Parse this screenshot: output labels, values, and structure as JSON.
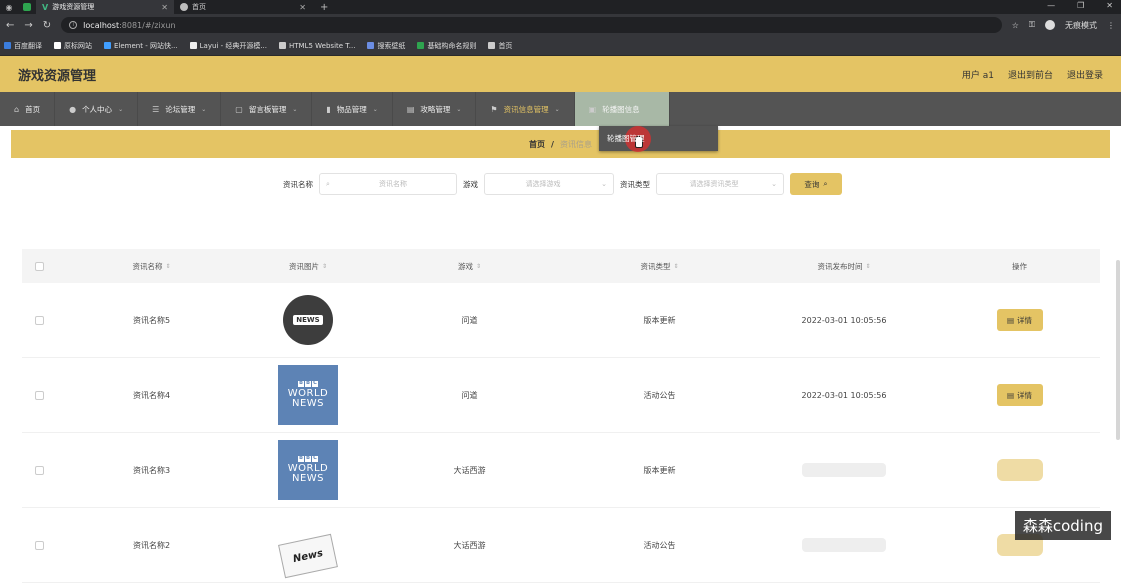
{
  "browser": {
    "tabs": [
      {
        "title": "游戏资源管理"
      },
      {
        "title": "首页"
      }
    ],
    "url_host": "localhost",
    "url_port": ":8081",
    "url_path": "/#/zixun",
    "incognito_label": "无痕模式",
    "bookmarks": [
      {
        "label": "百度翻译",
        "color": "#3b7ddd"
      },
      {
        "label": "原标网站",
        "color": "#ffffff"
      },
      {
        "label": "Element - 网站快...",
        "color": "#409eff"
      },
      {
        "label": "Layui - 经典开源模...",
        "color": "#eeeeee"
      },
      {
        "label": "HTML5 Website T...",
        "color": "#cccccc"
      },
      {
        "label": "搜索壁纸",
        "color": "#6b8de3"
      },
      {
        "label": "基础构命名规则",
        "color": "#2ea44f"
      },
      {
        "label": "首页",
        "color": "#cccccc"
      }
    ]
  },
  "app": {
    "title": "游戏资源管理",
    "user": "用户 a1",
    "back_front": "退出到前台",
    "logout": "退出登录",
    "accent": "#e4c464"
  },
  "nav": [
    {
      "label": "首页",
      "icon": "home-icon"
    },
    {
      "label": "个人中心",
      "icon": "user-icon"
    },
    {
      "label": "论坛管理",
      "icon": "list-icon"
    },
    {
      "label": "留言板管理",
      "icon": "message-icon"
    },
    {
      "label": "物品管理",
      "icon": "chart-icon"
    },
    {
      "label": "攻略管理",
      "icon": "doc-icon"
    },
    {
      "label": "资讯信息管理",
      "icon": "flag-icon"
    },
    {
      "label": "轮播图信息",
      "icon": "image-icon"
    }
  ],
  "dropdown": {
    "item": "轮播图管理"
  },
  "breadcrumb": {
    "home": "首页",
    "sep": "/",
    "current": "资讯信息"
  },
  "search": {
    "name_label": "资讯名称",
    "name_placeholder": "资讯名称",
    "game_label": "游戏",
    "game_placeholder": "请选择游戏",
    "type_label": "资讯类型",
    "type_placeholder": "请选择资讯类型",
    "query_label": "查询"
  },
  "table": {
    "headers": {
      "name": "资讯名称",
      "image": "资讯图片",
      "game": "游戏",
      "type": "资讯类型",
      "time": "资讯发布时间",
      "op": "操作"
    },
    "detail_label": "详情",
    "rows": [
      {
        "name": "资讯名称5",
        "image": "news-globe",
        "image_text": "NEWS",
        "game": "问道",
        "type": "版本更新",
        "time": "2022-03-01 10:05:56"
      },
      {
        "name": "资讯名称4",
        "image": "bbc-world-news",
        "image_logo": [
          "B",
          "B",
          "C"
        ],
        "image_l1": "WORLD",
        "image_l2": "NEWS",
        "game": "问道",
        "type": "活动公告",
        "time": "2022-03-01 10:05:56"
      },
      {
        "name": "资讯名称3",
        "image": "bbc-world-news",
        "image_logo": [
          "B",
          "B",
          "C"
        ],
        "image_l1": "WORLD",
        "image_l2": "NEWS",
        "game": "大话西游",
        "type": "版本更新",
        "time": ""
      },
      {
        "name": "资讯名称2",
        "image": "newspaper",
        "image_text": "News",
        "game": "大话西游",
        "type": "活动公告",
        "time": ""
      }
    ]
  },
  "watermark": "森森coding"
}
